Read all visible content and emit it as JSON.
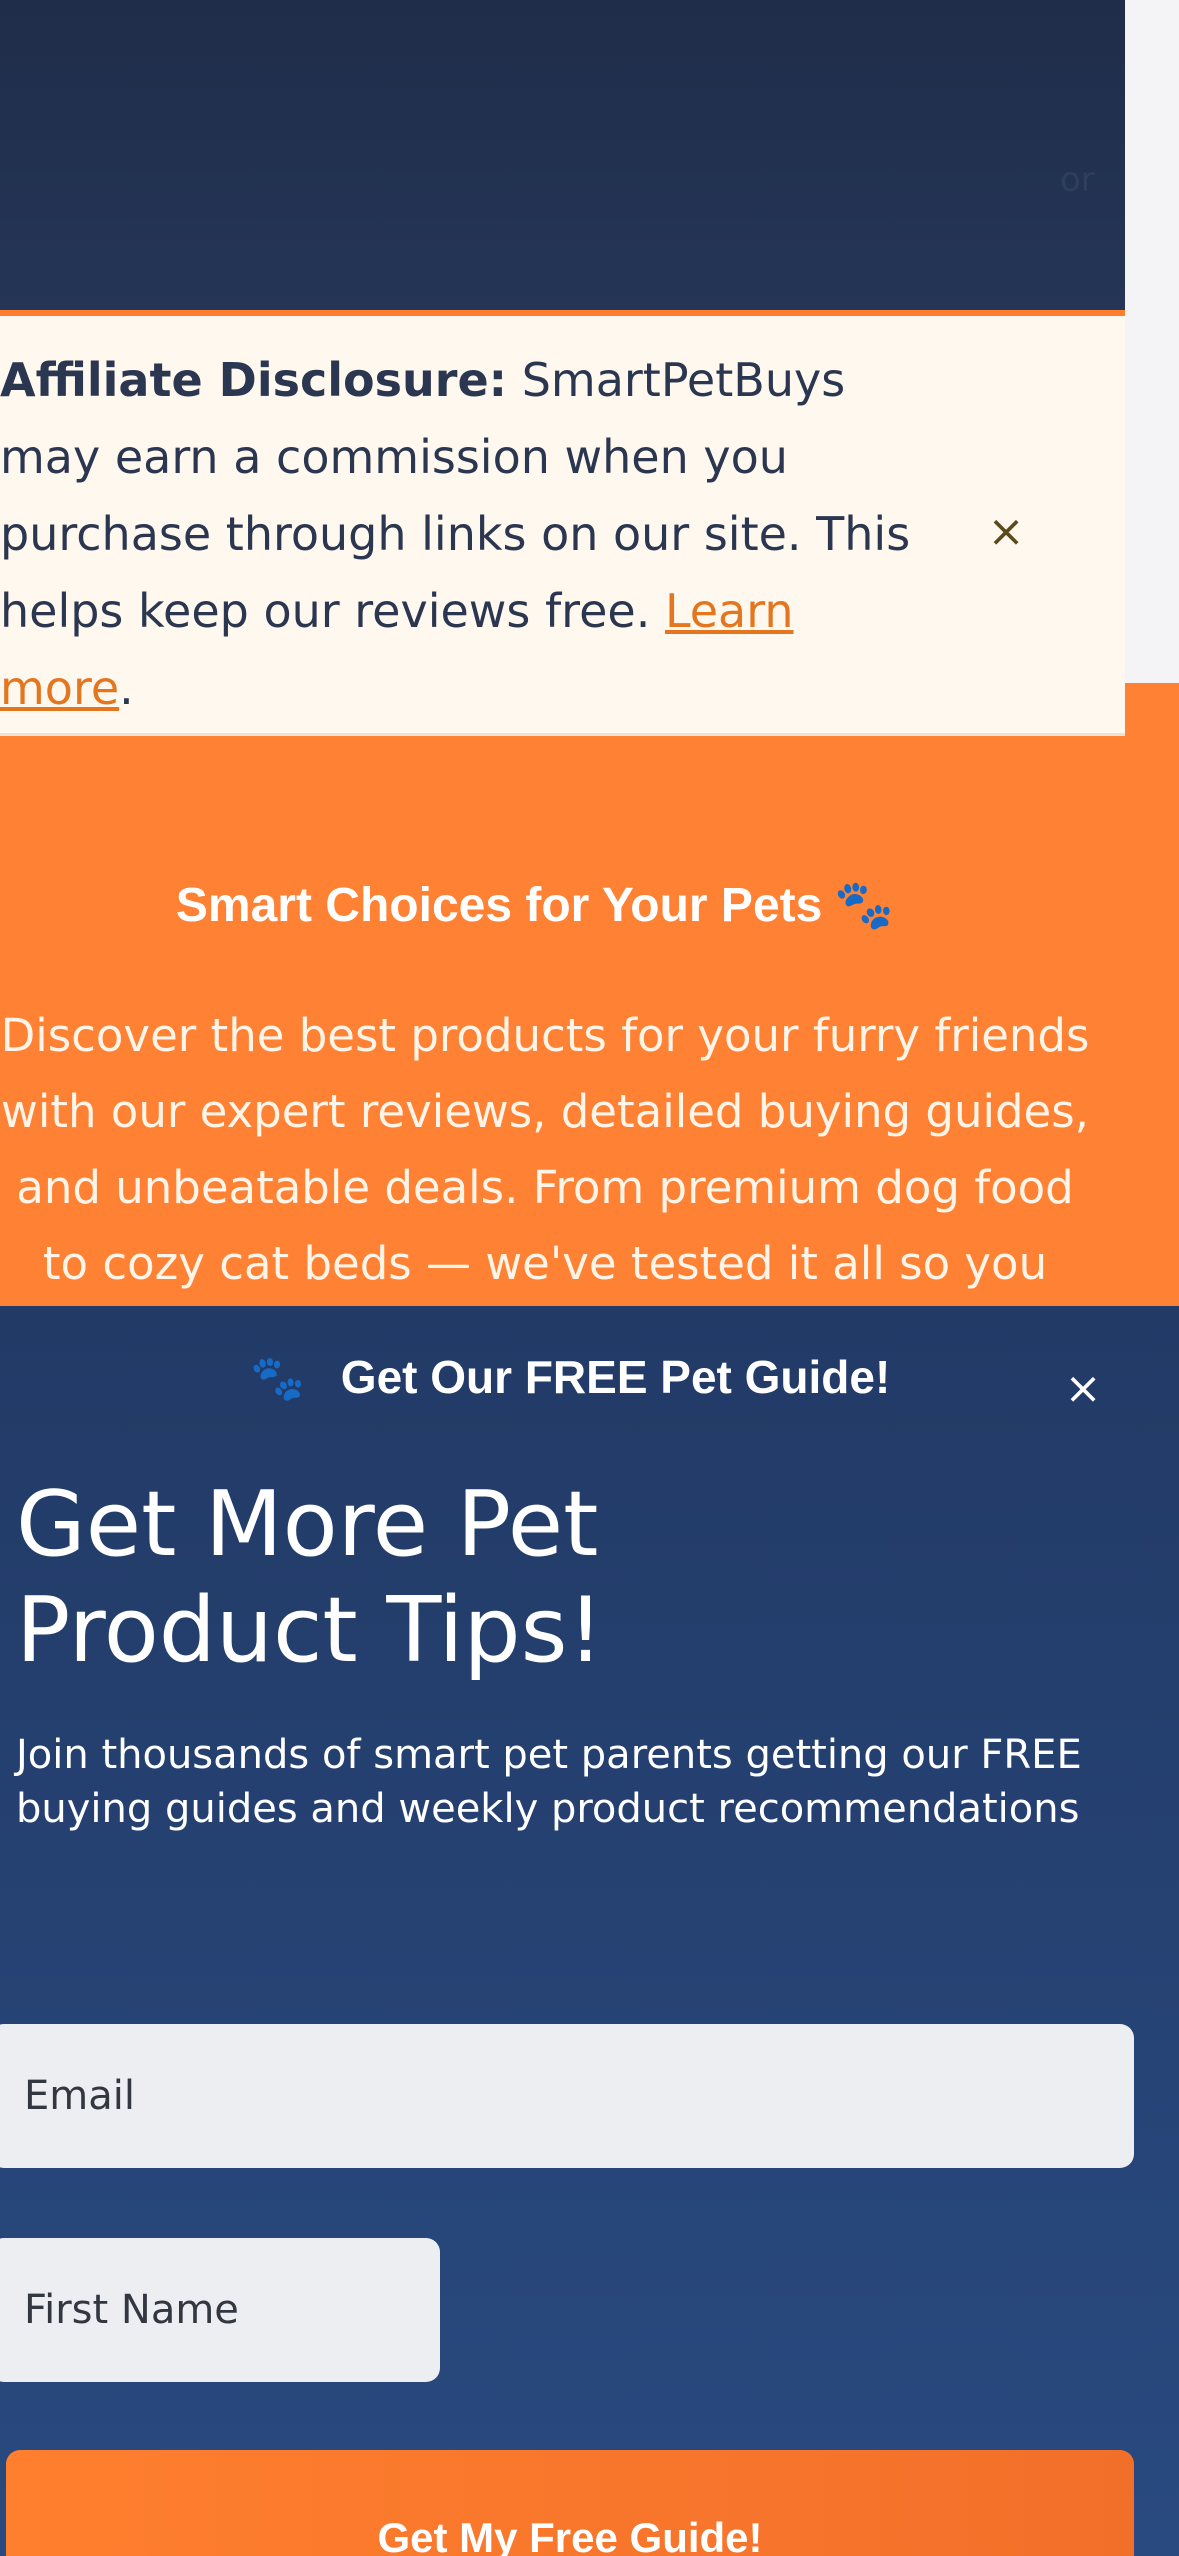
{
  "site": {
    "name": "SmartPetBuys",
    "header_faint_text": "or"
  },
  "disclosure": {
    "label": "Affiliate Disclosure:",
    "text": "SmartPetBuys may earn a commission when you purchase through links on our site. This helps keep our reviews free.",
    "link_label": "Learn more",
    "trailing": ".",
    "close_symbol": "×"
  },
  "hero": {
    "title": "Smart Choices for Your Pets",
    "title_emoji": "🐾",
    "text": "Discover the best products for your furry friends with our expert reviews, detailed buying guides, and unbeatable deals. From premium dog food to cozy cat beds — we've tested it all so you don't"
  },
  "popup": {
    "header_emoji": "🐾",
    "header_title": "Get Our FREE Pet Guide!",
    "close_symbol": "×",
    "heading": "Get More Pet Product Tips!",
    "subtext": "Join thousands of smart pet parents getting our FREE buying guides and weekly product recommendations",
    "email_placeholder": "Email",
    "first_name_placeholder": "First Name",
    "submit_label": "Get My Free Guide!"
  },
  "colors": {
    "header_bg": "#1f2d4a",
    "accent_orange": "#ff8133",
    "disclosure_bg": "#fff8ee",
    "popup_bg": "#294a80",
    "link": "#e3761f"
  }
}
